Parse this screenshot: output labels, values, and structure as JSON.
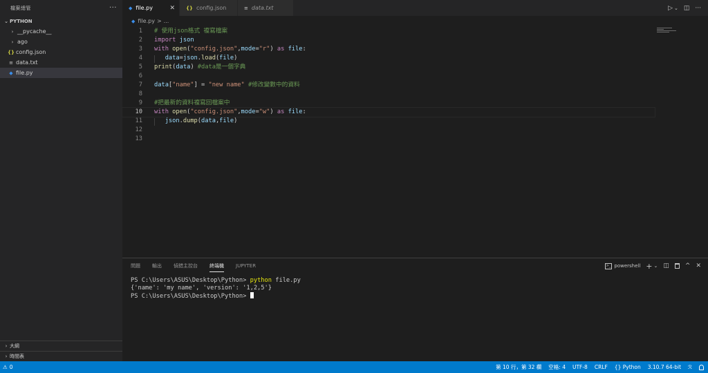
{
  "sidebar": {
    "title": "檔案總管",
    "more": "···",
    "section": "PYTHON",
    "items": [
      {
        "label": "__pycache__",
        "icon": "chevron-right-icon",
        "glyph": "›"
      },
      {
        "label": "ago",
        "icon": "chevron-right-icon",
        "glyph": "›"
      },
      {
        "label": "config.json",
        "icon": "json-file-icon",
        "glyph": "{}"
      },
      {
        "label": "data.txt",
        "icon": "text-file-icon",
        "glyph": "≡"
      },
      {
        "label": "file.py",
        "icon": "python-file-icon",
        "glyph": "◆"
      }
    ],
    "outline": "大綱",
    "timeline": "時間表"
  },
  "tabs": [
    {
      "label": "file.py",
      "glyph": "◆",
      "close": "✕"
    },
    {
      "label": "config.json",
      "glyph": "{}"
    },
    {
      "label": "data.txt",
      "glyph": "≡"
    }
  ],
  "tab_actions": {
    "run": "▷",
    "run_menu": "⌄",
    "split": "◫",
    "more": "···"
  },
  "breadcrumb": {
    "file": "file.py",
    "sep": ">",
    "rest": "..."
  },
  "editor": {
    "line_numbers": [
      "1",
      "2",
      "3",
      "4",
      "5",
      "6",
      "7",
      "8",
      "9",
      "10",
      "11",
      "12",
      "13"
    ],
    "current_line": 10,
    "lines": [
      [
        {
          "t": "# 使用json格式 複寫檔案",
          "c": "cmt"
        }
      ],
      [
        {
          "t": "import",
          "c": "kw"
        },
        {
          "t": " ",
          "c": "plain"
        },
        {
          "t": "json",
          "c": "var"
        }
      ],
      [
        {
          "t": "with",
          "c": "kw"
        },
        {
          "t": " ",
          "c": "plain"
        },
        {
          "t": "open",
          "c": "fn"
        },
        {
          "t": "(",
          "c": "plain"
        },
        {
          "t": "\"config.json\"",
          "c": "str"
        },
        {
          "t": ",",
          "c": "plain"
        },
        {
          "t": "mode",
          "c": "var"
        },
        {
          "t": "=",
          "c": "plain"
        },
        {
          "t": "\"r\"",
          "c": "str"
        },
        {
          "t": ") ",
          "c": "plain"
        },
        {
          "t": "as",
          "c": "kw"
        },
        {
          "t": " ",
          "c": "plain"
        },
        {
          "t": "file",
          "c": "var"
        },
        {
          "t": ":",
          "c": "plain"
        }
      ],
      [
        {
          "t": "   ",
          "c": "plain"
        },
        {
          "t": "data",
          "c": "var"
        },
        {
          "t": "=",
          "c": "plain"
        },
        {
          "t": "json",
          "c": "var"
        },
        {
          "t": ".",
          "c": "plain"
        },
        {
          "t": "load",
          "c": "fn"
        },
        {
          "t": "(",
          "c": "plain"
        },
        {
          "t": "file",
          "c": "var"
        },
        {
          "t": ")",
          "c": "plain"
        }
      ],
      [
        {
          "t": "print",
          "c": "fn"
        },
        {
          "t": "(",
          "c": "plain"
        },
        {
          "t": "data",
          "c": "var"
        },
        {
          "t": ") ",
          "c": "plain"
        },
        {
          "t": "#data是一個字典",
          "c": "cmt"
        }
      ],
      [],
      [
        {
          "t": "data",
          "c": "var"
        },
        {
          "t": "[",
          "c": "plain"
        },
        {
          "t": "\"name\"",
          "c": "str"
        },
        {
          "t": "] = ",
          "c": "plain"
        },
        {
          "t": "\"new name\"",
          "c": "str"
        },
        {
          "t": " ",
          "c": "plain"
        },
        {
          "t": "#修改變數中的資料",
          "c": "cmt"
        }
      ],
      [],
      [
        {
          "t": "#把最新的資料複寫回檔案中",
          "c": "cmt"
        }
      ],
      [
        {
          "t": "with",
          "c": "kw"
        },
        {
          "t": " ",
          "c": "plain"
        },
        {
          "t": "open",
          "c": "fn"
        },
        {
          "t": "(",
          "c": "plain"
        },
        {
          "t": "\"config.json\"",
          "c": "str"
        },
        {
          "t": ",",
          "c": "plain"
        },
        {
          "t": "mode",
          "c": "var"
        },
        {
          "t": "=",
          "c": "plain"
        },
        {
          "t": "\"w\"",
          "c": "str"
        },
        {
          "t": ") ",
          "c": "plain"
        },
        {
          "t": "as",
          "c": "kw"
        },
        {
          "t": " ",
          "c": "plain"
        },
        {
          "t": "file",
          "c": "var"
        },
        {
          "t": ":",
          "c": "plain"
        }
      ],
      [
        {
          "t": "   ",
          "c": "plain"
        },
        {
          "t": "json",
          "c": "var"
        },
        {
          "t": ".",
          "c": "plain"
        },
        {
          "t": "dump",
          "c": "fn"
        },
        {
          "t": "(",
          "c": "plain"
        },
        {
          "t": "data",
          "c": "var"
        },
        {
          "t": ",",
          "c": "plain"
        },
        {
          "t": "file",
          "c": "var"
        },
        {
          "t": ")",
          "c": "plain"
        }
      ],
      [],
      []
    ]
  },
  "panel": {
    "tabs": [
      "問題",
      "輸出",
      "偵錯主控台",
      "終端機",
      "JUPYTER"
    ],
    "active_tab": "終端機",
    "shell": "powershell",
    "shell_glyph": ">_",
    "actions": {
      "add": "+",
      "add_menu": "⌄",
      "split": "◫",
      "trash": "🗑",
      "maximize": "^",
      "close": "✕"
    },
    "terminal": {
      "prompt1": "PS C:\\Users\\ASUS\\Desktop\\Python>",
      "cmd": "python",
      "arg": "file.py",
      "output": "{'name': 'my name', 'version': '1,2,5'}",
      "prompt2": "PS C:\\Users\\ASUS\\Desktop\\Python>"
    }
  },
  "statusbar": {
    "errors_glyph": "⚠",
    "errors": "0",
    "position": "第 10 行，第 32 欄",
    "spaces": "空格: 4",
    "encoding": "UTF-8",
    "eol": "CRLF",
    "language_glyph": "{}",
    "language": "Python",
    "interpreter": "3.10.7 64-bit",
    "feedback_glyph": "ℛ",
    "bell_glyph": "🔔"
  }
}
